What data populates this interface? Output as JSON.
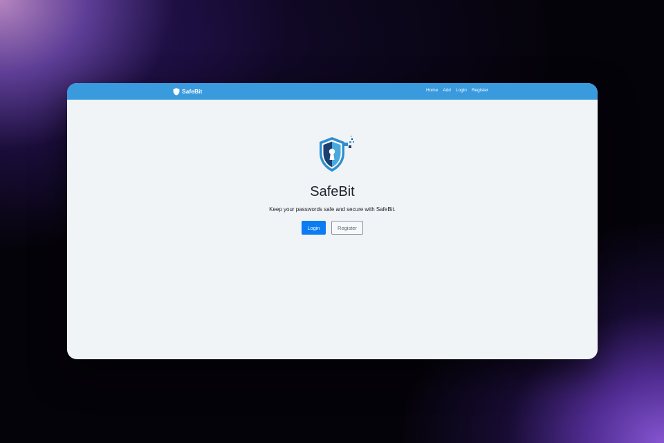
{
  "navbar": {
    "brand": "SafeBit",
    "brand_icon": "shield-icon",
    "links": [
      "Home",
      "Add",
      "Login",
      "Register"
    ],
    "background": "#3a9ade"
  },
  "hero": {
    "logo_icon": "shield-keyhole-icon",
    "title": "SafeBit",
    "tagline": "Keep your passwords safe and secure with SafeBit.",
    "login_label": "Login",
    "register_label": "Register"
  },
  "colors": {
    "accent": "#0b7cf2",
    "page_background": "#f1f4f7"
  }
}
